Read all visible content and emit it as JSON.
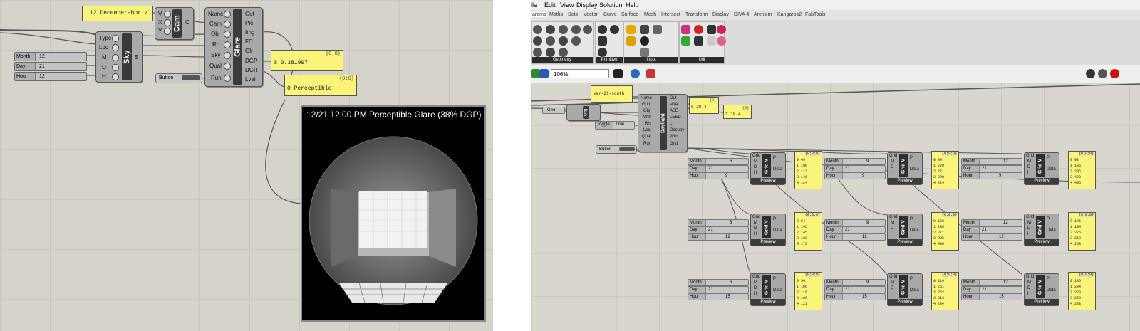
{
  "left": {
    "date_panel": "12 December-horiz",
    "cam_component": {
      "label": "Cam",
      "inputs": [
        "V",
        "X",
        "Y"
      ],
      "output": "C"
    },
    "glare_component": {
      "label": "Glare",
      "inputs": [
        "Name",
        "Cam",
        "Obj",
        "Rh",
        "Sky",
        "Qual",
        "Run"
      ],
      "outputs": [
        "Out",
        "Pic",
        "Img",
        "FC",
        "Glr",
        "DGP",
        "DGR",
        "Lvel"
      ]
    },
    "sky_component": {
      "label": "Sky",
      "inputs": [
        "Type",
        "Loc",
        "M",
        "D",
        "H"
      ],
      "output": "S"
    },
    "sliders": [
      {
        "name": "Month",
        "value": "12"
      },
      {
        "name": "Day",
        "value": "21"
      },
      {
        "name": "Hour",
        "value": "12"
      }
    ],
    "button": "Button",
    "dgp_panel": {
      "header": "{0;0}",
      "value": "0 0.381997"
    },
    "glare_panel": {
      "header": "{0;0}",
      "value": "0 Perceptible"
    },
    "viewer_caption": "12/21 12:00 PM   Perceptible Glare (38% DGP)"
  },
  "right": {
    "menu": [
      "ile",
      "Edit",
      "View",
      "Display",
      "Solution",
      "Help"
    ],
    "tabs": [
      "arams",
      "Maths",
      "Sets",
      "Vector",
      "Curve",
      "Surface",
      "Mesh",
      "Intersect",
      "Transform",
      "Display",
      "DIVA 4",
      "Archsim",
      "Kangaroo2",
      "FabTools"
    ],
    "ribbon_groups": [
      "Geometry",
      "Primitive",
      "Input",
      "Util"
    ],
    "zoom": "106%",
    "top_panel": "vmr-21-south",
    "daylight_component": {
      "label": "Daylight",
      "inputs": [
        "Name",
        "Grid",
        "Obj",
        "Wth",
        "Rh",
        "Loc",
        "Qual",
        "Run"
      ],
      "outputs": [
        "Out",
        "sDA",
        "ASE",
        "LEED",
        "LI",
        "Occupy",
        "Wth",
        "Grid"
      ]
    },
    "panel_sda": {
      "header": "{0}",
      "value": "0 20.4"
    },
    "panel_ase": {
      "header": "{0}",
      "value": "1 10.4"
    },
    "geo": "Geo",
    "obj": "Obj",
    "toggle": {
      "name": "Toggle",
      "value": "True"
    },
    "button": "Button",
    "gridv_label": "Grid V",
    "preview": "Preview",
    "grid_rows": [
      [
        {
          "month": "6",
          "day": "21",
          "hour": "9",
          "vals": [
            "0 49",
            "1 106",
            "2 112",
            "3 146",
            "4 124"
          ]
        },
        {
          "month": "9",
          "day": "21",
          "hour": "9",
          "vals": [
            "0 34",
            "1 220",
            "2 271",
            "3 208",
            "4 224"
          ]
        },
        {
          "month": "12",
          "day": "21",
          "hour": "9",
          "vals": [
            "0 92",
            "1 186",
            "2 296",
            "3 420",
            "4 406"
          ]
        }
      ],
      [
        {
          "month": "6",
          "day": "21",
          "hour": "12",
          "vals": [
            "0 54",
            "1 145",
            "2 145",
            "3 192",
            "4 172"
          ]
        },
        {
          "month": "9",
          "day": "21",
          "hour": "12",
          "vals": [
            "0 160",
            "1 280",
            "2 271",
            "3 335",
            "4 406"
          ]
        },
        {
          "month": "12",
          "day": "21",
          "hour": "12",
          "vals": [
            "0 145",
            "1 194",
            "2 226",
            "3 263",
            "4 263"
          ]
        }
      ],
      [
        {
          "month": "6",
          "day": "21",
          "hour": "15",
          "vals": [
            "0 54",
            "1 106",
            "2 116",
            "3 106",
            "4 121"
          ]
        },
        {
          "month": "9",
          "day": "21",
          "hour": "15",
          "vals": [
            "0 114",
            "1 251",
            "2 252",
            "3 216",
            "4 204"
          ]
        },
        {
          "month": "12",
          "day": "21",
          "hour": "15",
          "vals": [
            "0 136",
            "1 294",
            "2 220",
            "3 263",
            "4 233"
          ]
        }
      ]
    ],
    "data_header": "{0;0;0}",
    "grid_inputs": [
      "Grid",
      "M",
      "D",
      "H"
    ],
    "grid_outputs": [
      "P",
      "Data"
    ]
  }
}
